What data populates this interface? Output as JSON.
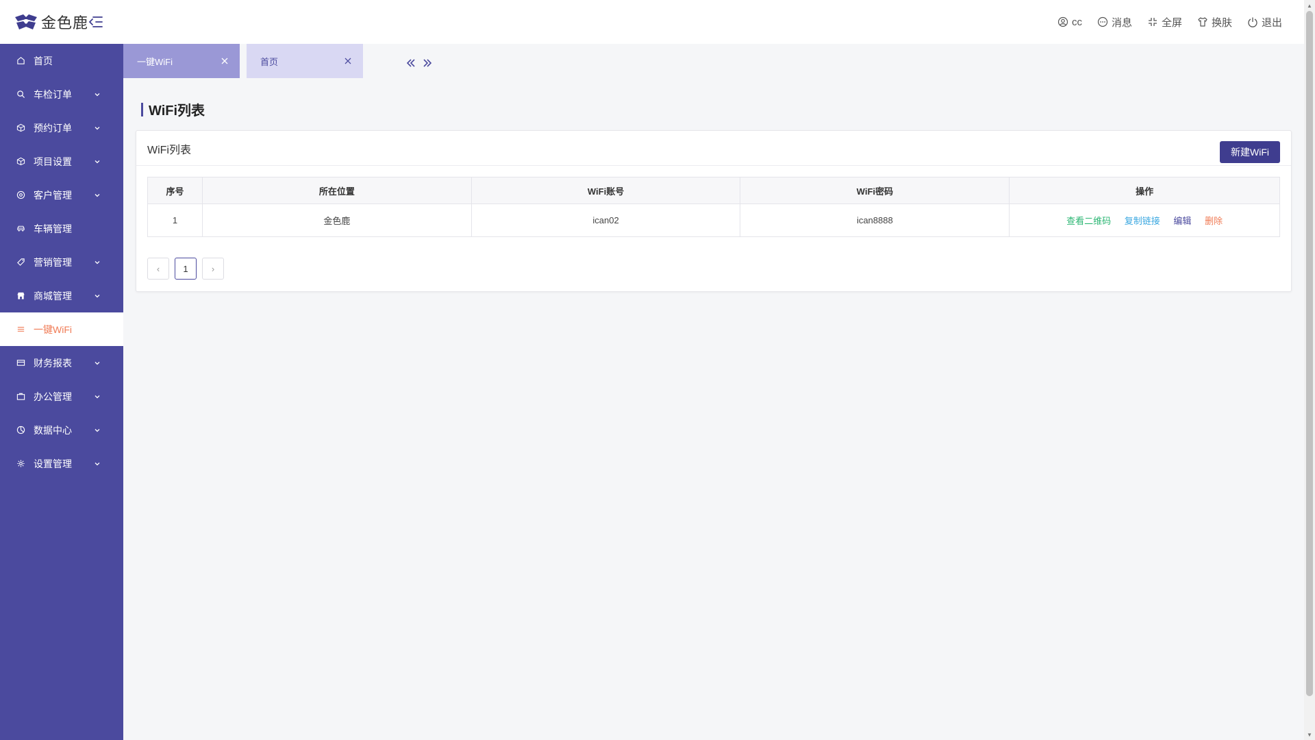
{
  "header": {
    "brand": "金色鹿",
    "actions": [
      {
        "icon": "user-icon",
        "label": "cc"
      },
      {
        "icon": "message-icon",
        "label": "消息"
      },
      {
        "icon": "fullscreen-icon",
        "label": "全屏"
      },
      {
        "icon": "shirt-icon",
        "label": "换肤"
      },
      {
        "icon": "power-icon",
        "label": "退出"
      }
    ]
  },
  "sidebar": {
    "items": [
      {
        "label": "首页",
        "icon": "home-icon",
        "expandable": false
      },
      {
        "label": "车检订单",
        "icon": "search-icon",
        "expandable": true
      },
      {
        "label": "预约订单",
        "icon": "cube-icon",
        "expandable": true
      },
      {
        "label": "项目设置",
        "icon": "cube-icon",
        "expandable": true
      },
      {
        "label": "客户管理",
        "icon": "at-icon",
        "expandable": true
      },
      {
        "label": "车辆管理",
        "icon": "car-icon",
        "expandable": false
      },
      {
        "label": "营销管理",
        "icon": "tag-icon",
        "expandable": true
      },
      {
        "label": "商城管理",
        "icon": "shop-icon",
        "expandable": true
      },
      {
        "label": "一键WiFi",
        "icon": "list-icon",
        "expandable": false,
        "active": true
      },
      {
        "label": "财务报表",
        "icon": "card-icon",
        "expandable": true
      },
      {
        "label": "办公管理",
        "icon": "briefcase-icon",
        "expandable": true
      },
      {
        "label": "数据中心",
        "icon": "pie-icon",
        "expandable": true
      },
      {
        "label": "设置管理",
        "icon": "gear-icon",
        "expandable": true
      }
    ]
  },
  "tabs": [
    {
      "label": "一键WiFi",
      "active": true
    },
    {
      "label": "首页",
      "active": false
    }
  ],
  "page": {
    "title": "WiFi列表"
  },
  "card": {
    "title": "WiFi列表",
    "new_button": "新建WiFi"
  },
  "table": {
    "columns": [
      "序号",
      "所在位置",
      "WiFi账号",
      "WiFi密码",
      "操作"
    ],
    "rows": [
      {
        "index": "1",
        "location": "金色鹿",
        "account": "ican02",
        "password": "ican8888"
      }
    ],
    "actions": {
      "qr": "查看二维码",
      "copy": "复制链接",
      "edit": "编辑",
      "delete": "删除"
    }
  },
  "pager": {
    "prev": "‹",
    "current": "1",
    "next": "›"
  },
  "colors": {
    "sidebar": "#4b4a9e",
    "active_text": "#f07b55",
    "primary_button": "#3f3d8f"
  }
}
